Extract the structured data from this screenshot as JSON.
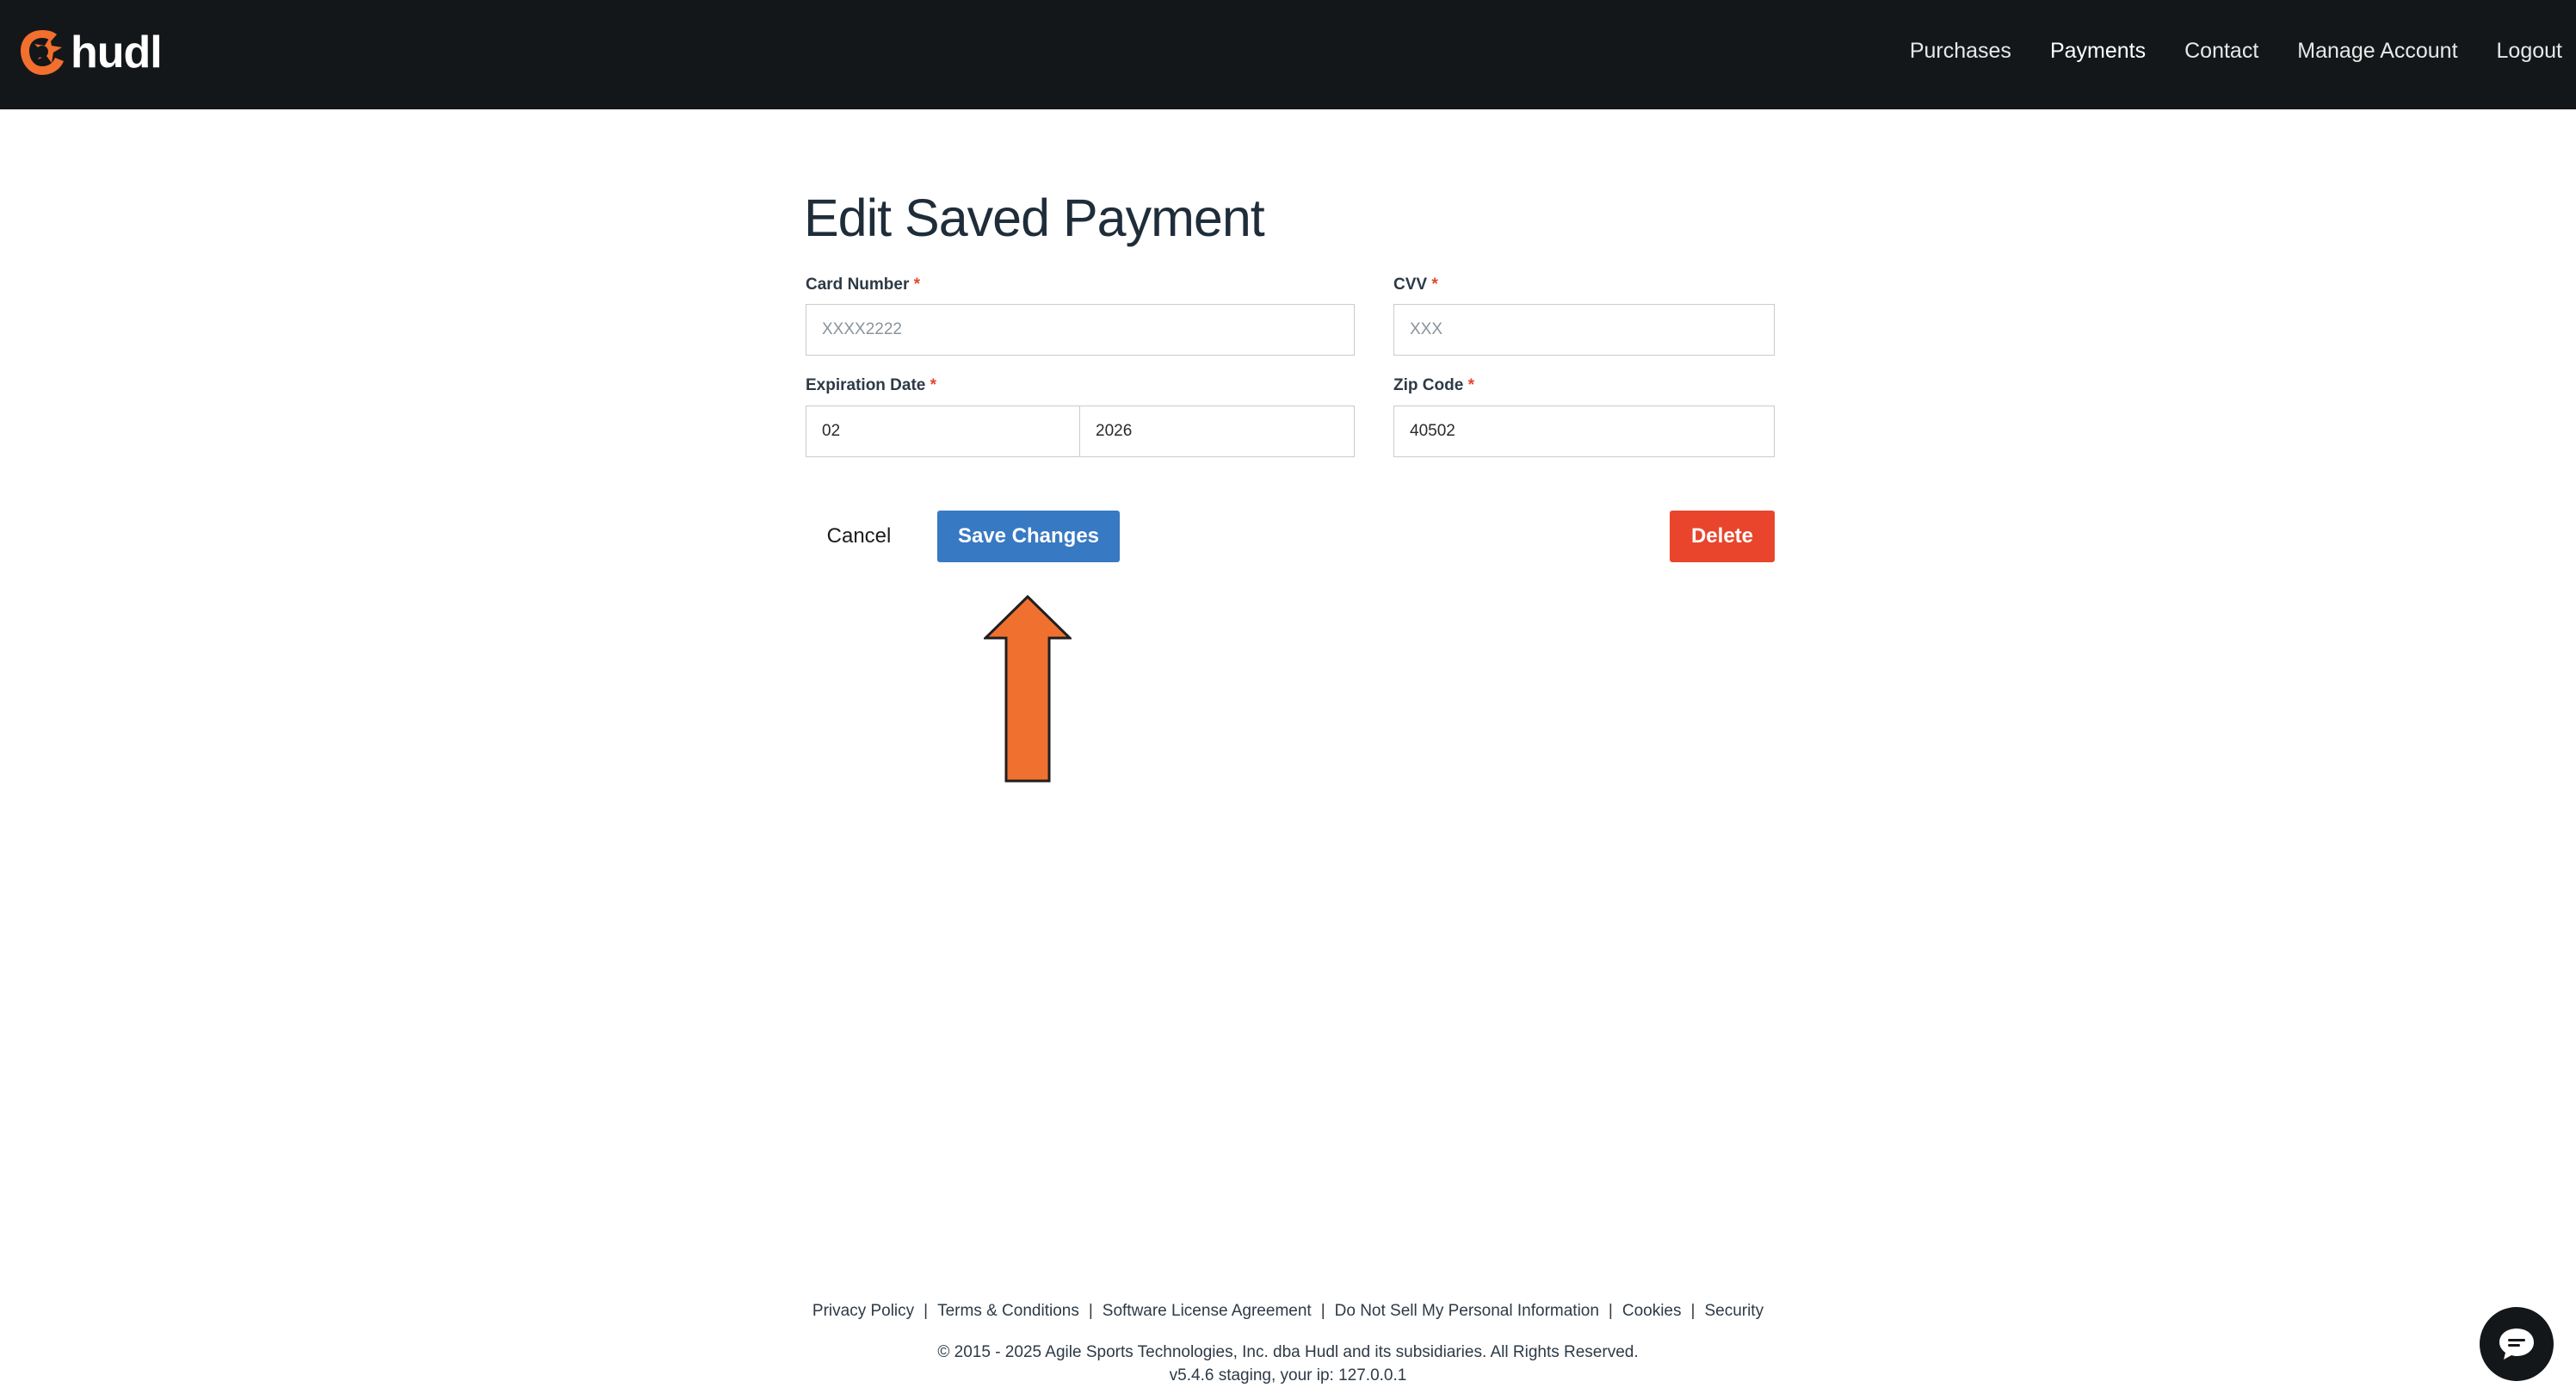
{
  "header": {
    "logo_text": "hudl",
    "nav": [
      "Purchases",
      "Payments",
      "Contact",
      "Manage Account",
      "Logout"
    ],
    "active": "Payments"
  },
  "form": {
    "title": "Edit Saved Payment",
    "card_number": {
      "label": "Card Number",
      "required_mark": "*",
      "value": "",
      "placeholder": "XXXX2222"
    },
    "cvv": {
      "label": "CVV",
      "required_mark": "*",
      "value": "",
      "placeholder": "XXX"
    },
    "expiration": {
      "label": "Expiration Date",
      "required_mark": "*",
      "month": "02",
      "year": "2026"
    },
    "zip": {
      "label": "Zip Code",
      "required_mark": "*",
      "value": "40502"
    },
    "cancel_label": "Cancel",
    "save_label": "Save Changes",
    "delete_label": "Delete"
  },
  "footer": {
    "links": [
      "Privacy Policy",
      "Terms & Conditions",
      "Software License Agreement",
      "Do Not Sell My Personal Information",
      "Cookies",
      "Security"
    ],
    "separator": "|",
    "copyright": "© 2015 - 2025 Agile Sports Technologies, Inc. dba Hudl and its subsidiaries. All Rights Reserved.",
    "version": "v5.4.6 staging, your ip: 127.0.0.1"
  },
  "colors": {
    "header_bg": "#14171a",
    "brand_orange": "#f26f2d",
    "save_blue": "#3779c2",
    "delete_red": "#e8452c",
    "annotation_arrow": "#f07030"
  },
  "icons": [
    "hudl-logo-icon",
    "up-arrow-annotation-icon",
    "chat-bubble-icon"
  ]
}
